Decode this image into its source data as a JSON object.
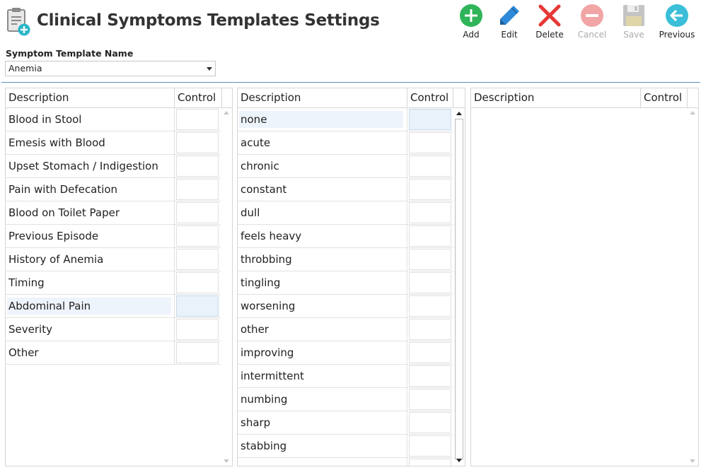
{
  "header": {
    "title": "Clinical Symptoms Templates Settings"
  },
  "toolbar": {
    "add_label": "Add",
    "edit_label": "Edit",
    "delete_label": "Delete",
    "cancel_label": "Cancel",
    "save_label": "Save",
    "previous_label": "Previous"
  },
  "template": {
    "label": "Symptom Template Name",
    "selected": "Anemia"
  },
  "colors": {
    "add": "#2fb45a",
    "edit": "#2e8ad8",
    "delete": "#e53935",
    "cancel": "#f2a5a5",
    "save": "#bdbdbd",
    "previous": "#3bbfd8",
    "separator": "#5b8fb8",
    "selection": "#eef4fb"
  },
  "grid_left": {
    "headers": {
      "description": "Description",
      "control": "Control"
    },
    "rows": [
      "Blood in Stool",
      "Emesis with Blood",
      "Upset Stomach / Indigestion",
      "Pain with Defecation",
      "Blood on Toilet Paper",
      "Previous Episode",
      "History of Anemia",
      "Timing",
      "Abdominal Pain",
      "Severity",
      "Other"
    ],
    "selected_row": "Abdominal Pain"
  },
  "grid_middle": {
    "headers": {
      "description": "Description",
      "control": "Control"
    },
    "rows": [
      "none",
      "acute",
      "chronic",
      "constant",
      "dull",
      "feels heavy",
      "throbbing",
      "tingling",
      "worsening",
      "other",
      "improving",
      "intermittent",
      "numbing",
      "sharp",
      "stabbing"
    ],
    "selected_row": "none"
  },
  "grid_right": {
    "headers": {
      "description": "Description",
      "control": "Control"
    },
    "rows": []
  }
}
